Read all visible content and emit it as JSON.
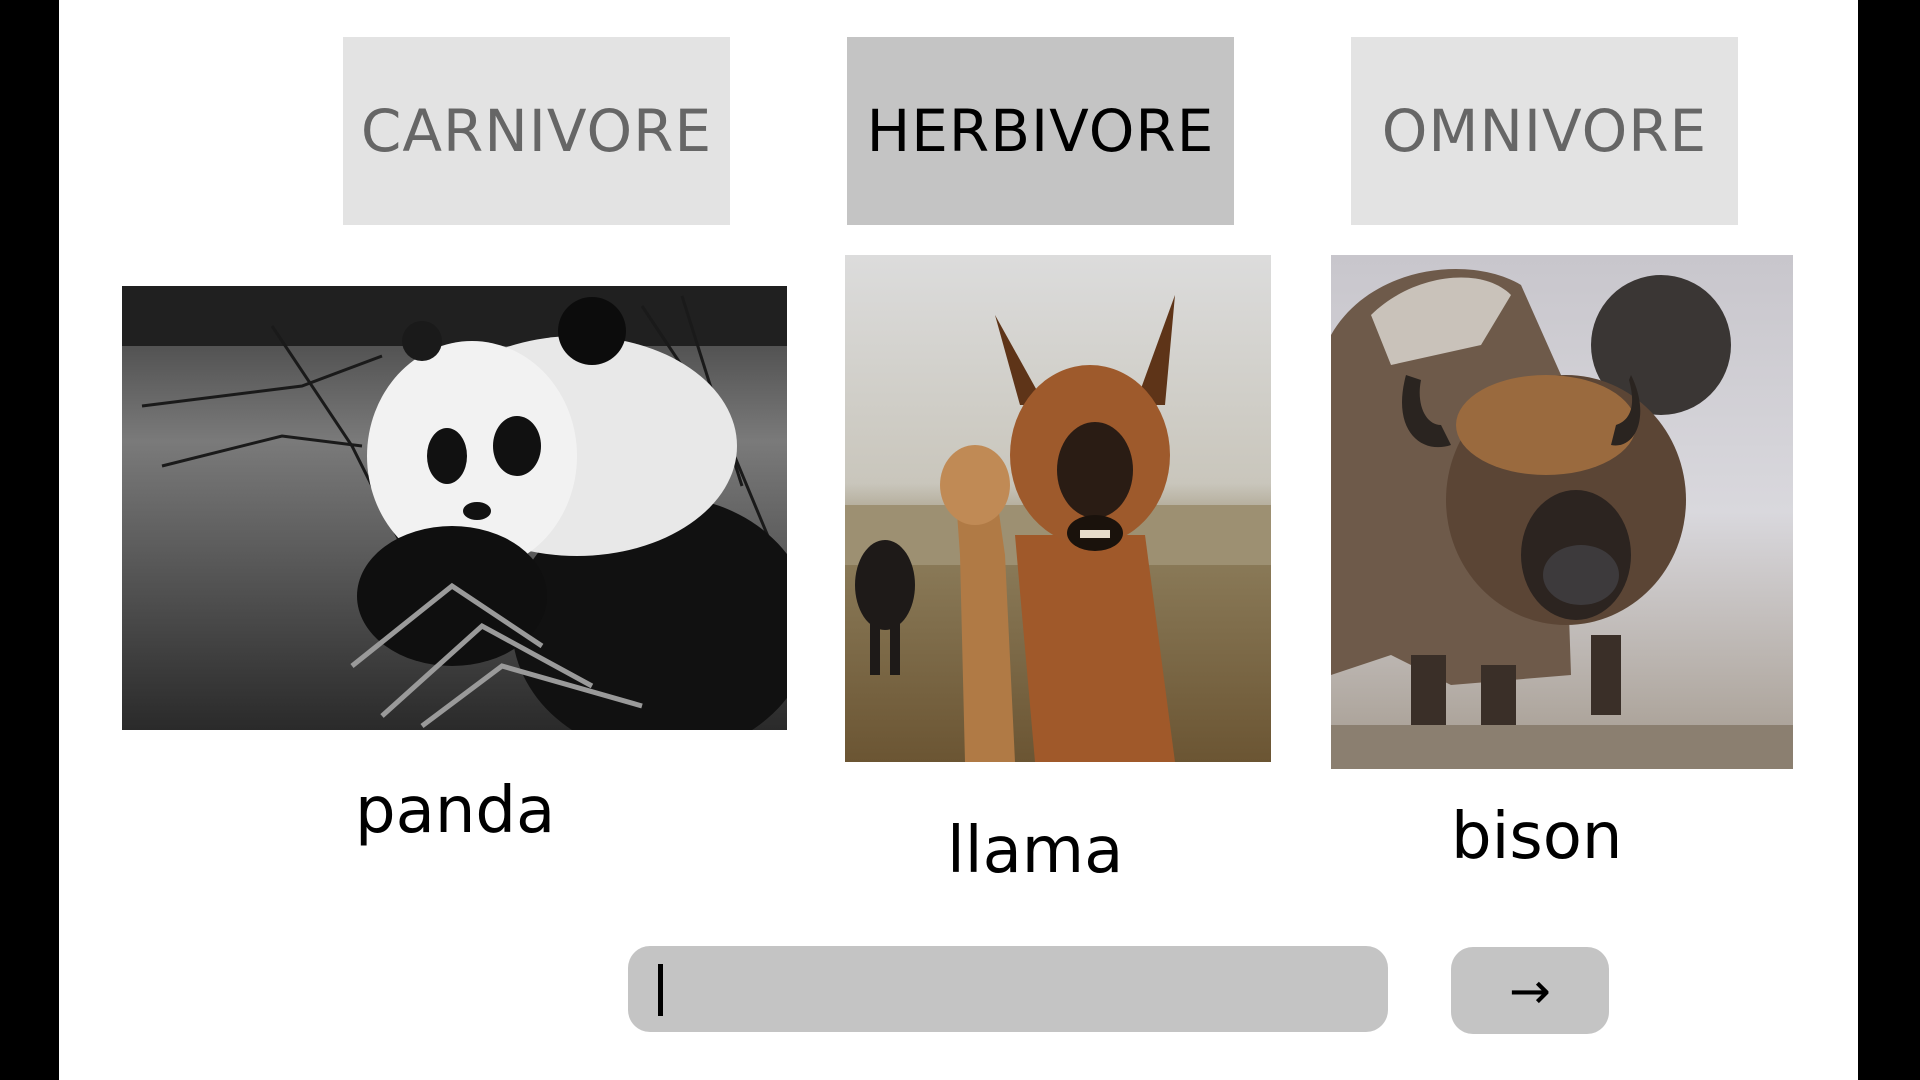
{
  "categories": {
    "carnivore": "CARNIVORE",
    "herbivore": "HERBIVORE",
    "omnivore": "OMNIVORE"
  },
  "animals": {
    "panda": "panda",
    "llama": "llama",
    "bison": "bison"
  },
  "answer": {
    "value": ""
  },
  "submit": {
    "label": "→"
  }
}
